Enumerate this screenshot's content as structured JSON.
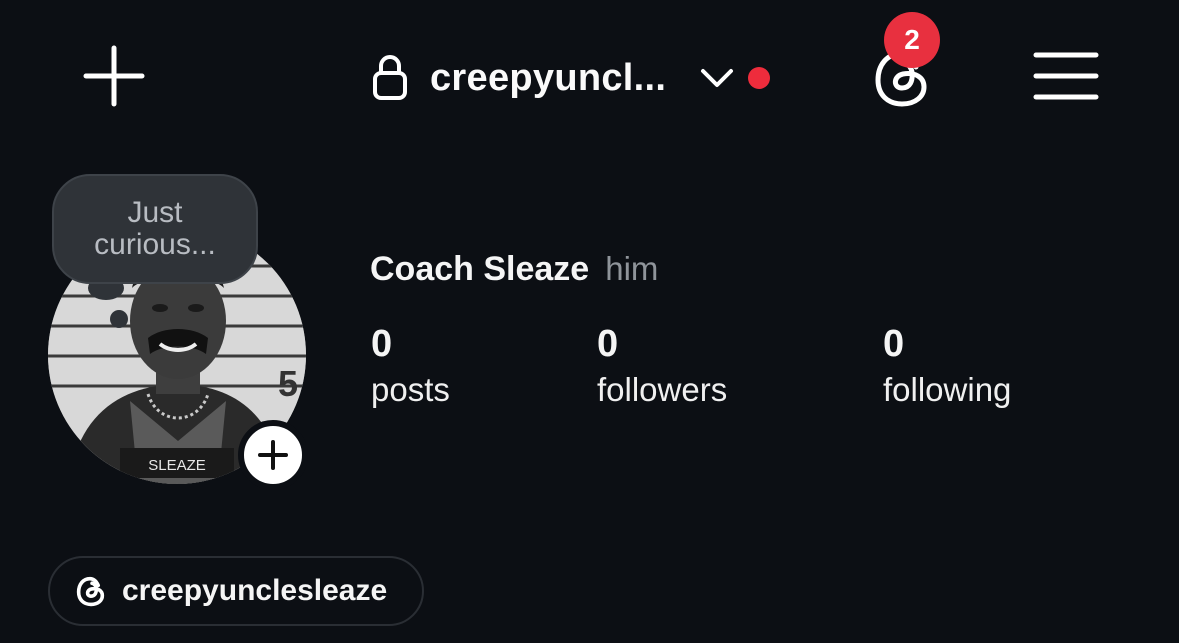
{
  "header": {
    "username_truncated": "creepyuncl...",
    "notification_count": "2"
  },
  "profile": {
    "display_name": "Coach Sleaze",
    "pronouns": "him",
    "note": "Just curious...",
    "avatar_plate_text": "SLEAZE",
    "stats": [
      {
        "value": "0",
        "label": "posts"
      },
      {
        "value": "0",
        "label": "followers"
      },
      {
        "value": "0",
        "label": "following"
      }
    ],
    "threads_handle": "creepyunclesleaze"
  },
  "colors": {
    "background": "#0c0f14",
    "badge": "#e8303f",
    "unread_dot": "#ee2c3c",
    "bubble": "#2f3338",
    "muted_text": "#8f949a"
  },
  "icons": {
    "create": "plus-icon",
    "privacy": "lock-icon",
    "switcher": "chevron-down-icon",
    "threads": "threads-icon",
    "menu": "hamburger-menu-icon",
    "add_story": "plus-icon"
  }
}
